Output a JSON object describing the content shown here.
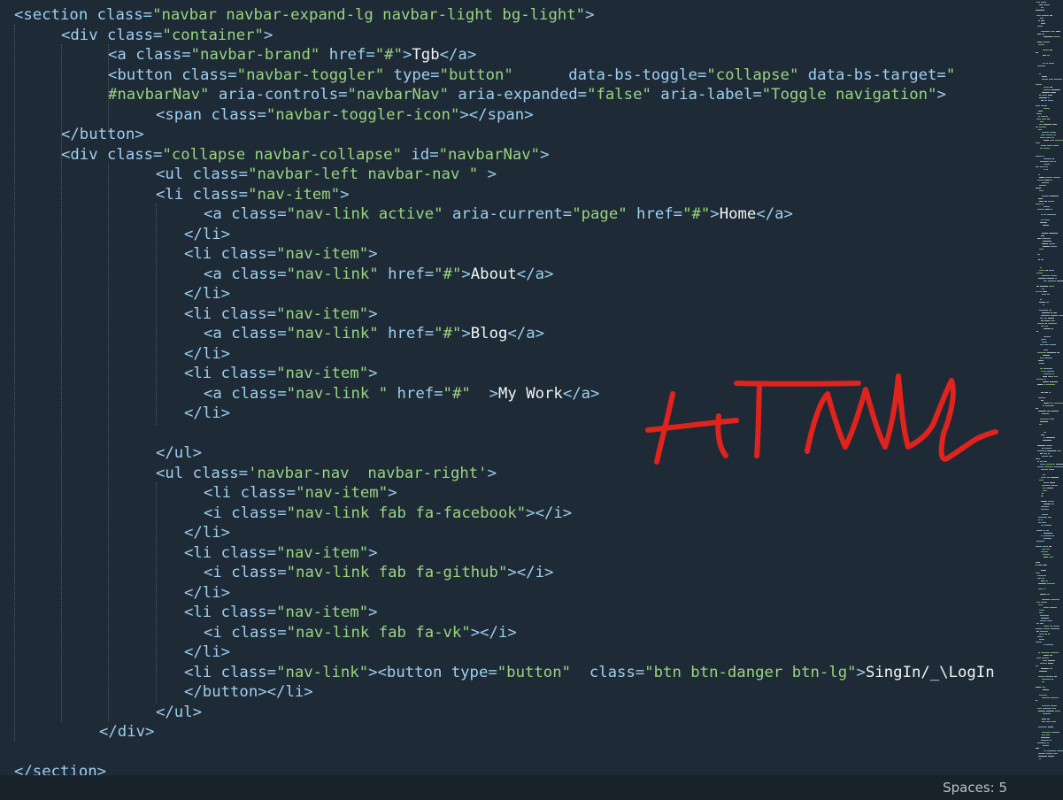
{
  "editor": {
    "lines": [
      [
        [
          "t",
          "<section "
        ],
        [
          "a",
          "class="
        ],
        [
          "s",
          "\"navbar navbar-expand-lg navbar-light bg-light\""
        ],
        [
          "t",
          ">"
        ]
      ],
      [
        [
          "t",
          "<div "
        ],
        [
          "a",
          "class="
        ],
        [
          "s",
          "\"container\""
        ],
        [
          "t",
          ">"
        ]
      ],
      [
        [
          "t",
          "<a "
        ],
        [
          "a",
          "class="
        ],
        [
          "s",
          "\"navbar-brand\""
        ],
        [
          "a",
          " href="
        ],
        [
          "s",
          "\"#\""
        ],
        [
          "t",
          ">"
        ],
        [
          "p",
          "Tgb"
        ],
        [
          "t",
          "</a>"
        ]
      ],
      [
        [
          "t",
          "<button "
        ],
        [
          "a",
          "class="
        ],
        [
          "s",
          "\"navbar-toggler\""
        ],
        [
          "a",
          " type="
        ],
        [
          "s",
          "\"button\""
        ],
        [
          "a",
          "      data-bs-toggle="
        ],
        [
          "s",
          "\"collapse\""
        ],
        [
          "a",
          " data-bs-target="
        ],
        [
          "s",
          "\""
        ]
      ],
      [
        [
          "s",
          "#navbarNav\""
        ],
        [
          "a",
          " aria-controls="
        ],
        [
          "s",
          "\"navbarNav\""
        ],
        [
          "a",
          " aria-expanded="
        ],
        [
          "s",
          "\"false\""
        ],
        [
          "a",
          " aria-label="
        ],
        [
          "s",
          "\"Toggle navigation\""
        ],
        [
          "t",
          ">"
        ]
      ],
      [
        [
          "t",
          "<span "
        ],
        [
          "a",
          "class="
        ],
        [
          "s",
          "\"navbar-toggler-icon\""
        ],
        [
          "t",
          "></span>"
        ]
      ],
      [
        [
          "t",
          "</button>"
        ]
      ],
      [
        [
          "t",
          "<div "
        ],
        [
          "a",
          "class="
        ],
        [
          "s",
          "\"collapse navbar-collapse\""
        ],
        [
          "a",
          " id="
        ],
        [
          "s",
          "\"navbarNav\""
        ],
        [
          "t",
          ">"
        ]
      ],
      [
        [
          "t",
          "<ul "
        ],
        [
          "a",
          "class="
        ],
        [
          "s",
          "\"navbar-left navbar-nav \""
        ],
        [
          "t",
          " >"
        ]
      ],
      [
        [
          "t",
          "<li "
        ],
        [
          "a",
          "class="
        ],
        [
          "s",
          "\"nav-item\""
        ],
        [
          "t",
          ">"
        ]
      ],
      [
        [
          "t",
          "<a "
        ],
        [
          "a",
          "class="
        ],
        [
          "s",
          "\"nav-link active\""
        ],
        [
          "a",
          " aria-current="
        ],
        [
          "s",
          "\"page\""
        ],
        [
          "a",
          " href="
        ],
        [
          "s",
          "\"#\""
        ],
        [
          "t",
          ">"
        ],
        [
          "p",
          "Home"
        ],
        [
          "t",
          "</a>"
        ]
      ],
      [
        [
          "t",
          "</li>"
        ]
      ],
      [
        [
          "t",
          "<li "
        ],
        [
          "a",
          "class="
        ],
        [
          "s",
          "\"nav-item\""
        ],
        [
          "t",
          ">"
        ]
      ],
      [
        [
          "t",
          "<a "
        ],
        [
          "a",
          "class="
        ],
        [
          "s",
          "\"nav-link\""
        ],
        [
          "a",
          " href="
        ],
        [
          "s",
          "\"#\""
        ],
        [
          "t",
          ">"
        ],
        [
          "p",
          "About"
        ],
        [
          "t",
          "</a>"
        ]
      ],
      [
        [
          "t",
          "</li>"
        ]
      ],
      [
        [
          "t",
          "<li "
        ],
        [
          "a",
          "class="
        ],
        [
          "s",
          "\"nav-item\""
        ],
        [
          "t",
          ">"
        ]
      ],
      [
        [
          "t",
          "<a "
        ],
        [
          "a",
          "class="
        ],
        [
          "s",
          "\"nav-link\""
        ],
        [
          "a",
          " href="
        ],
        [
          "s",
          "\"#\""
        ],
        [
          "t",
          ">"
        ],
        [
          "p",
          "Blog"
        ],
        [
          "t",
          "</a>"
        ]
      ],
      [
        [
          "t",
          "</li>"
        ]
      ],
      [
        [
          "t",
          "<li "
        ],
        [
          "a",
          "class="
        ],
        [
          "s",
          "\"nav-item\""
        ],
        [
          "t",
          ">"
        ]
      ],
      [
        [
          "t",
          "<a "
        ],
        [
          "a",
          "class="
        ],
        [
          "s",
          "\"nav-link \""
        ],
        [
          "a",
          " href="
        ],
        [
          "s",
          "\"#\""
        ],
        [
          "t",
          "  >"
        ],
        [
          "p",
          "My Work"
        ],
        [
          "t",
          "</a>"
        ]
      ],
      [
        [
          "t",
          "</li>"
        ]
      ],
      [],
      [
        [
          "t",
          "</ul>"
        ]
      ],
      [
        [
          "t",
          "<ul "
        ],
        [
          "a",
          "class="
        ],
        [
          "s",
          "'navbar-nav  navbar-right'"
        ],
        [
          "t",
          ">"
        ]
      ],
      [
        [
          "t",
          "<li "
        ],
        [
          "a",
          "class="
        ],
        [
          "s",
          "\"nav-item\""
        ],
        [
          "t",
          ">"
        ]
      ],
      [
        [
          "t",
          "<i "
        ],
        [
          "a",
          "class="
        ],
        [
          "s",
          "\"nav-link fab fa-facebook\""
        ],
        [
          "t",
          "></i>"
        ]
      ],
      [
        [
          "t",
          "</li>"
        ]
      ],
      [
        [
          "t",
          "<li "
        ],
        [
          "a",
          "class="
        ],
        [
          "s",
          "\"nav-item\""
        ],
        [
          "t",
          ">"
        ]
      ],
      [
        [
          "t",
          "<i "
        ],
        [
          "a",
          "class="
        ],
        [
          "s",
          "\"nav-link fab fa-github\""
        ],
        [
          "t",
          "></i>"
        ]
      ],
      [
        [
          "t",
          "</li>"
        ]
      ],
      [
        [
          "t",
          "<li "
        ],
        [
          "a",
          "class="
        ],
        [
          "s",
          "\"nav-item\""
        ],
        [
          "t",
          ">"
        ]
      ],
      [
        [
          "t",
          "<i "
        ],
        [
          "a",
          "class="
        ],
        [
          "s",
          "\"nav-link fab fa-vk\""
        ],
        [
          "t",
          "></i>"
        ]
      ],
      [
        [
          "t",
          "</li>"
        ]
      ],
      [
        [
          "t",
          "<li "
        ],
        [
          "a",
          "class="
        ],
        [
          "s",
          "\"nav-link\""
        ],
        [
          "t",
          "><button "
        ],
        [
          "a",
          "type="
        ],
        [
          "s",
          "\"button\""
        ],
        [
          "a",
          "  class="
        ],
        [
          "s",
          "\"btn btn-danger btn-lg\""
        ],
        [
          "t",
          ">"
        ],
        [
          "p",
          "SingIn/_\\LogIn"
        ]
      ],
      [
        [
          "t",
          "</button></li>"
        ]
      ],
      [
        [
          "t",
          "</ul>"
        ]
      ],
      [
        [
          "t",
          "</div>"
        ]
      ],
      [],
      [
        [
          "t",
          "</section>"
        ]
      ]
    ],
    "colors": {
      "background": "#1e2b37",
      "tag": "#9ecfef",
      "string": "#99d37f",
      "text": "#f1f4f6",
      "ink": "#e0231d"
    }
  },
  "annotation": {
    "text": "HTML"
  },
  "statusbar": {
    "spaces": "Spaces: 5"
  }
}
